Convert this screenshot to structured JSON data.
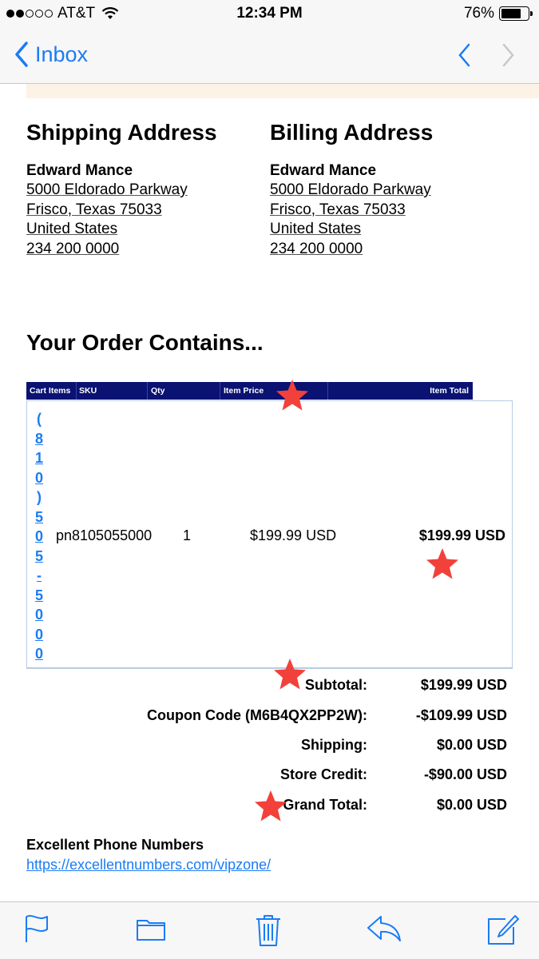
{
  "status_bar": {
    "carrier": "AT&T",
    "time": "12:34 PM",
    "battery": "76%",
    "battery_level": 0.76
  },
  "nav": {
    "back_label": "Inbox",
    "prev_icon": "chevron-up-icon",
    "next_icon": "chevron-down-icon"
  },
  "shipping": {
    "heading": "Shipping Address",
    "name": "Edward Mance",
    "street": "5000 Eldorado Parkway",
    "city": "Frisco, Texas 75033",
    "country": "United States",
    "phone": "234 200 0000"
  },
  "billing": {
    "heading": "Billing Address",
    "name": "Edward Mance",
    "street": "5000 Eldorado Parkway",
    "city": "Frisco, Texas 75033",
    "country": "United States",
    "phone": "234 200 0000"
  },
  "order": {
    "title": "Your Order Contains...",
    "columns": [
      "Cart Items",
      "SKU",
      "Qty",
      "Item Price",
      "Item Total"
    ],
    "items": [
      {
        "name_chars": [
          "(",
          "8",
          "1",
          "0",
          ")",
          "5",
          "0",
          "5",
          "-",
          "5",
          "0",
          "0",
          "0"
        ],
        "sku": "pn8105055000",
        "qty": "1",
        "price": "$199.99 USD",
        "total": "$199.99 USD"
      }
    ]
  },
  "totals": {
    "subtotal_label": "Subtotal:",
    "subtotal": "$199.99 USD",
    "coupon_label": "Coupon Code (M6B4QX2PP2W):",
    "coupon": "-$109.99 USD",
    "shipping_label": "Shipping:",
    "shipping": "$0.00 USD",
    "credit_label": "Store Credit:",
    "credit": "-$90.00 USD",
    "grand_label": "Grand Total:",
    "grand": "$0.00 USD"
  },
  "footer": {
    "company": "Excellent Phone Numbers",
    "link": "https://excellentnumbers.com/vipzone/"
  },
  "toolbar": {
    "icons": [
      "flag-icon",
      "folder-icon",
      "trash-icon",
      "reply-icon",
      "compose-icon"
    ]
  },
  "colors": {
    "accent": "#1a7cf5",
    "table_header": "#0a1272",
    "star": "#f2413a"
  }
}
